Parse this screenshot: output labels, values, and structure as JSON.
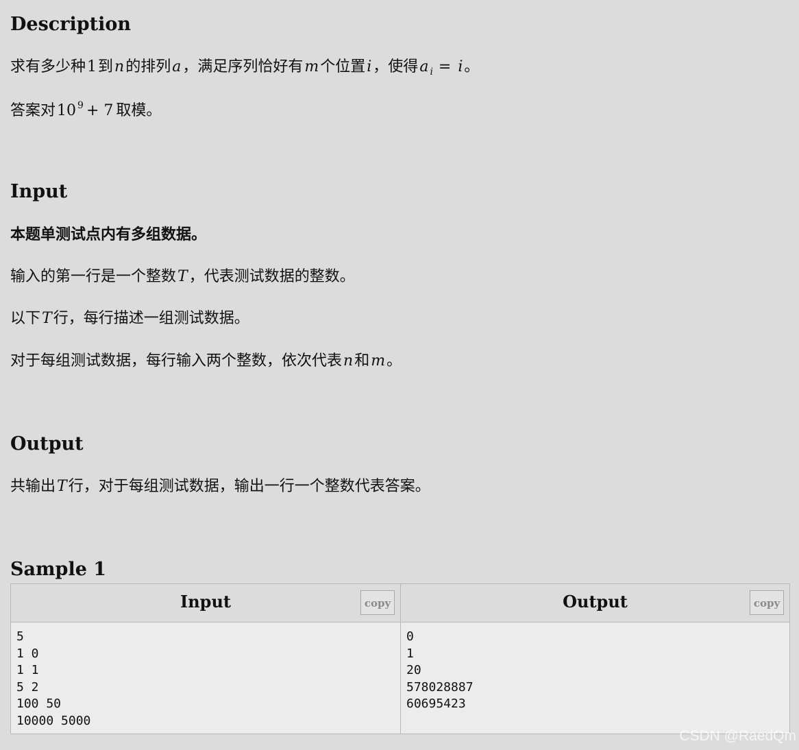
{
  "description": {
    "heading": "Description",
    "line1": {
      "t1": "求有多少种",
      "m1": "1",
      "t2": "到",
      "m2": "n",
      "t3": "的排列",
      "m3": "a",
      "t4": "，满足序列恰好有",
      "m4": "m",
      "t5": "个位置",
      "m5": "i",
      "t6": "，使得",
      "m6_base": "a",
      "m6_sub": "i",
      "m6_eq": "=",
      "m6_rhs": "i",
      "t7": "。"
    },
    "line2": {
      "t1": "答案对",
      "base": "10",
      "exp": "9",
      "plus": "+ 7",
      "t2": "取模。"
    }
  },
  "input": {
    "heading": "Input",
    "bold_line": "本题单测试点内有多组数据。",
    "line1": {
      "t1": "输入的第一行是一个整数",
      "m1": "T",
      "t2": "，代表测试数据的整数。"
    },
    "line2": {
      "t1": "以下",
      "m1": "T",
      "t2": "行，每行描述一组测试数据。"
    },
    "line3": {
      "t1": "对于每组测试数据，每行输入两个整数，依次代表",
      "m1": "n",
      "t2": "和",
      "m2": "m",
      "t3": "。"
    }
  },
  "output": {
    "heading": "Output",
    "line1": {
      "t1": "共输出",
      "m1": "T",
      "t2": "行，对于每组测试数据，输出一行一个整数代表答案。"
    }
  },
  "sample": {
    "heading": "Sample 1",
    "input_title": "Input",
    "output_title": "Output",
    "copy_label": "copy",
    "input_lines": [
      "5",
      "1 0",
      "1 1",
      "5 2",
      "100 50",
      "10000 5000"
    ],
    "output_lines": [
      "0",
      "1",
      "20",
      "578028887",
      "60695423"
    ]
  },
  "watermark": "CSDN @RaedQm"
}
